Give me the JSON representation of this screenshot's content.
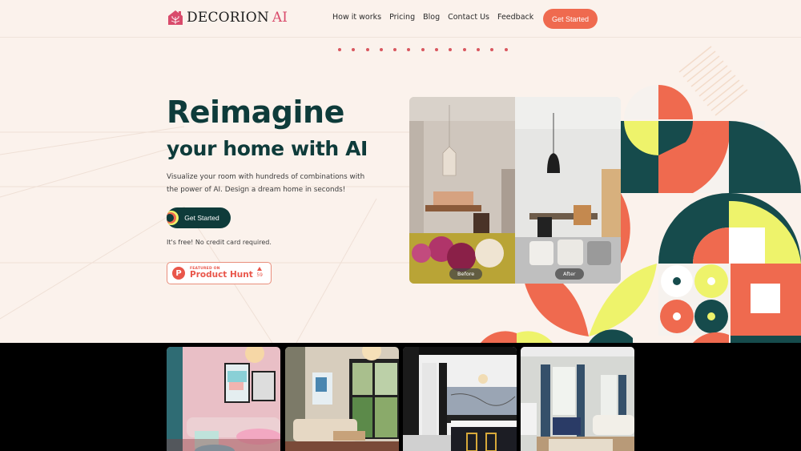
{
  "header": {
    "logo_text": "DECORION",
    "logo_accent": "AI",
    "nav": [
      "How it works",
      "Pricing",
      "Blog",
      "Contact Us",
      "Feedback"
    ],
    "cta_label": "Get Started"
  },
  "carousel": {
    "dot_count": 13
  },
  "hero": {
    "title": "Reimagine",
    "subtitle": "your home with AI",
    "description": "Visualize your room with hundreds of combinations with the power of AI. Design a dream home in seconds!",
    "cta_label": "Get Started",
    "note": "It's free! No credit card required.",
    "product_hunt": {
      "featured_label": "FEATURED ON",
      "name": "Product Hunt",
      "votes": "59",
      "icon_letter": "P"
    }
  },
  "comparison": {
    "before_label": "Before",
    "after_label": "After"
  },
  "gallery": {
    "items": [
      {
        "name": "pink-living-room"
      },
      {
        "name": "beige-living-room"
      },
      {
        "name": "marble-kitchen"
      },
      {
        "name": "navy-living-room"
      }
    ]
  },
  "colors": {
    "background": "#fbf2ec",
    "primary_dark": "#0e3b3a",
    "accent_coral": "#ef6a4f",
    "accent_yellow": "#eef36b",
    "logo_pink": "#d94b6b",
    "geo_teal": "#164b4c"
  }
}
